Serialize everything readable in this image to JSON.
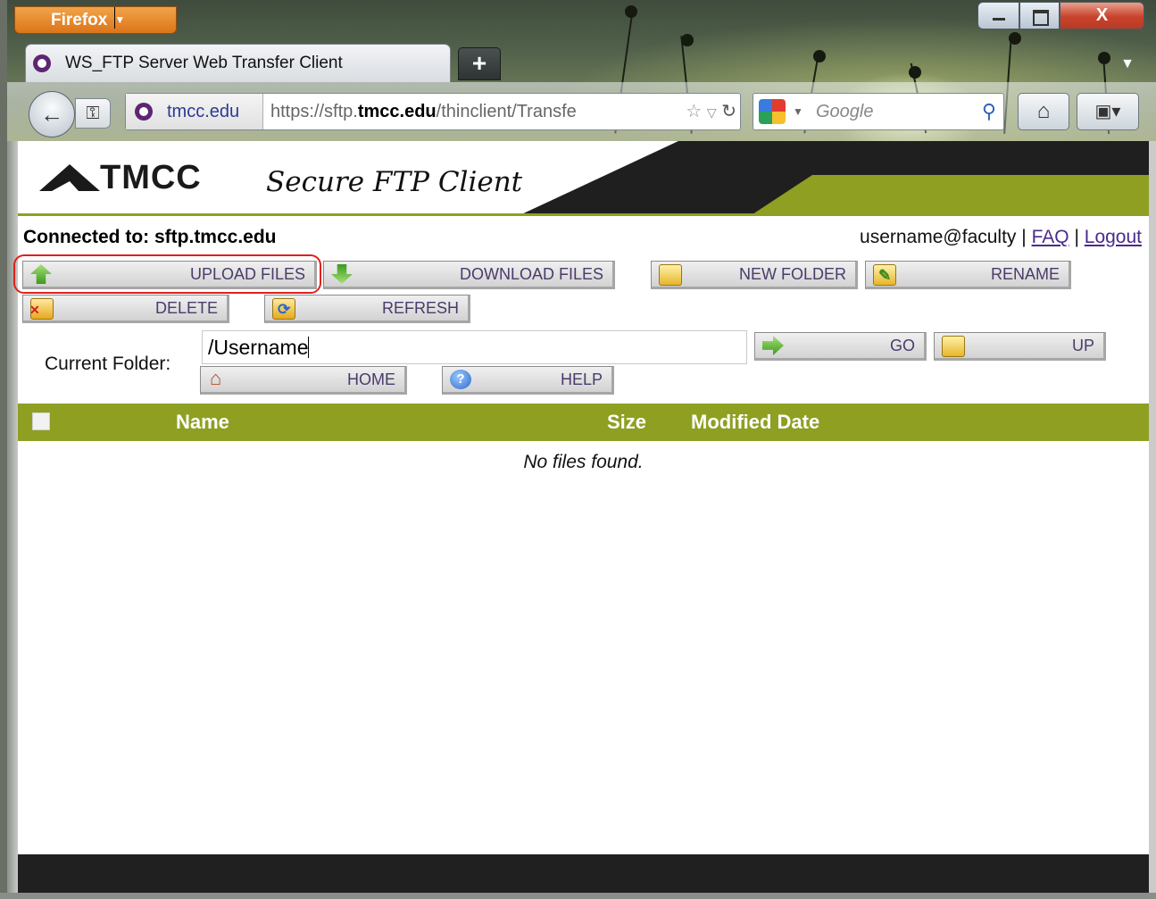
{
  "browser": {
    "menu_label": "Firefox",
    "close_glyph": "X",
    "tab_title": "WS_FTP Server Web Transfer Client",
    "new_tab": "+",
    "identity": "tmcc.edu",
    "url_prefix": "https://sftp.",
    "url_host": "tmcc.edu",
    "url_rest": "/thinclient/Transfe",
    "search_placeholder": "Google"
  },
  "banner": {
    "logo_text": "TMCC",
    "subtitle": "Secure FTP Client"
  },
  "session": {
    "connected_label": "Connected to: sftp.tmcc.edu",
    "user": "username@faculty",
    "sep1": "|",
    "faq": "FAQ",
    "sep2": "|",
    "logout": "Logout"
  },
  "toolbar": {
    "upload": "UPLOAD FILES",
    "download": "DOWNLOAD FILES",
    "new_folder": "NEW FOLDER",
    "rename": "RENAME",
    "delete": "DELETE",
    "refresh": "REFRESH",
    "go": "GO",
    "up": "UP",
    "home": "HOME",
    "help": "HELP"
  },
  "folder": {
    "label": "Current Folder:",
    "value": "/Username"
  },
  "table": {
    "columns": [
      "Name",
      "Size",
      "Modified Date"
    ],
    "empty_message": "No files found."
  },
  "colors": {
    "accent_green": "#8f9f22",
    "banner_dark": "#1f1f1f",
    "highlight_red": "#e0201c"
  }
}
